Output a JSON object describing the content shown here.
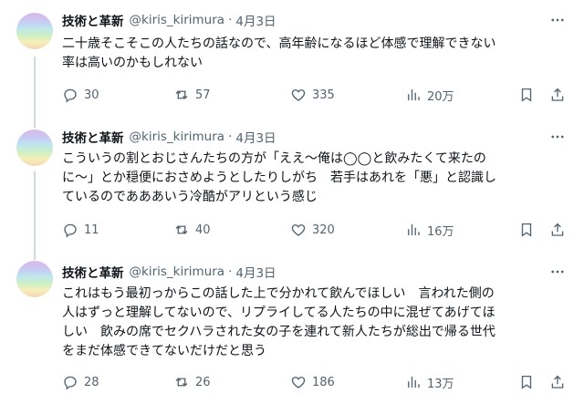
{
  "tweets": [
    {
      "name": "技術と革新",
      "handle": "@kiris_kirimura",
      "date": "4月3日",
      "text": "二十歳そこそこの人たちの話なので、高年齢になるほど体感で理解できない\n率は高いのかもしれない",
      "replies": "30",
      "retweets": "57",
      "likes": "335",
      "views": "20万"
    },
    {
      "name": "技術と革新",
      "handle": "@kiris_kirimura",
      "date": "4月3日",
      "text": "こういうの割とおじさんたちの方が「ええ〜俺は◯◯と飲みたくて来たの\nに〜」とか穏便におさめようとしたりしがち　若手はあれを「悪」と認識し\nているのであああいう冷酷がアリという感じ",
      "replies": "11",
      "retweets": "40",
      "likes": "320",
      "views": "16万"
    },
    {
      "name": "技術と革新",
      "handle": "@kiris_kirimura",
      "date": "4月3日",
      "text": "これはもう最初っからこの話した上で分かれて飲んでほしい　言われた側の\n人はずっと理解してないので、リプライしてる人たちの中に混ぜてあげてほ\nしい　飲みの席でセクハラされた女の子を連れて新人たちが総出で帰る世代\nをまだ体感できてないだけだと思う",
      "replies": "28",
      "retweets": "26",
      "likes": "186",
      "views": "13万"
    }
  ],
  "icons": {
    "more": "more-horizontal-icon",
    "reply": "reply-icon",
    "retweet": "retweet-icon",
    "like": "heart-icon",
    "views": "views-icon",
    "bookmark": "bookmark-icon",
    "share": "share-icon"
  },
  "colors": {
    "text": "#0f1419",
    "secondary": "#536471",
    "thread_line": "#cfd9de"
  }
}
